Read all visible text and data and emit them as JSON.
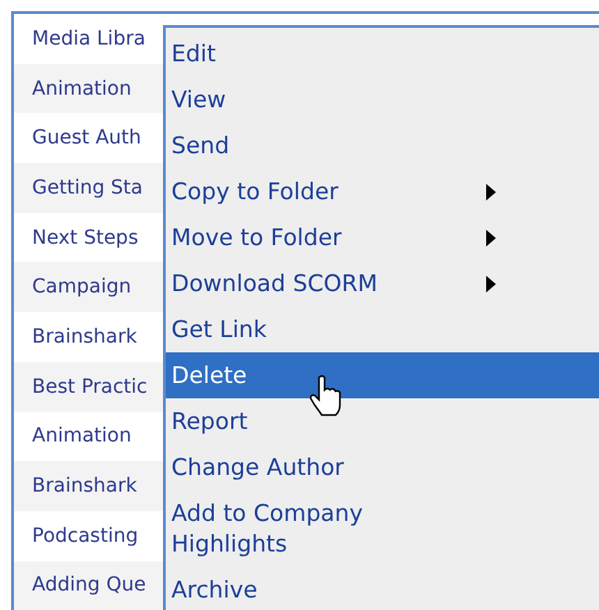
{
  "list": {
    "rows": [
      {
        "title": "Media Libra"
      },
      {
        "title": "Animation"
      },
      {
        "title": "Guest Auth"
      },
      {
        "title": "Getting Sta"
      },
      {
        "title": "Next Steps"
      },
      {
        "title": "Campaign"
      },
      {
        "title": "Brainshark"
      },
      {
        "title": "Best Practic"
      },
      {
        "title": "Animation"
      },
      {
        "title": "Brainshark"
      },
      {
        "title": "Podcasting"
      },
      {
        "title": "Adding Que"
      }
    ]
  },
  "context_menu": {
    "items": [
      {
        "label": "Edit",
        "submenu": false,
        "selected": false
      },
      {
        "label": "View",
        "submenu": false,
        "selected": false
      },
      {
        "label": "Send",
        "submenu": false,
        "selected": false
      },
      {
        "label": "Copy to Folder",
        "submenu": true,
        "selected": false
      },
      {
        "label": "Move to Folder",
        "submenu": true,
        "selected": false
      },
      {
        "label": "Download SCORM",
        "submenu": true,
        "selected": false
      },
      {
        "label": "Get Link",
        "submenu": false,
        "selected": false
      },
      {
        "label": "Delete",
        "submenu": false,
        "selected": true
      },
      {
        "label": "Report",
        "submenu": false,
        "selected": false
      },
      {
        "label": "Change Author",
        "submenu": false,
        "selected": false
      },
      {
        "label": "Add to Company Highlights",
        "submenu": false,
        "selected": false
      },
      {
        "label": "Archive",
        "submenu": false,
        "selected": false
      }
    ]
  }
}
